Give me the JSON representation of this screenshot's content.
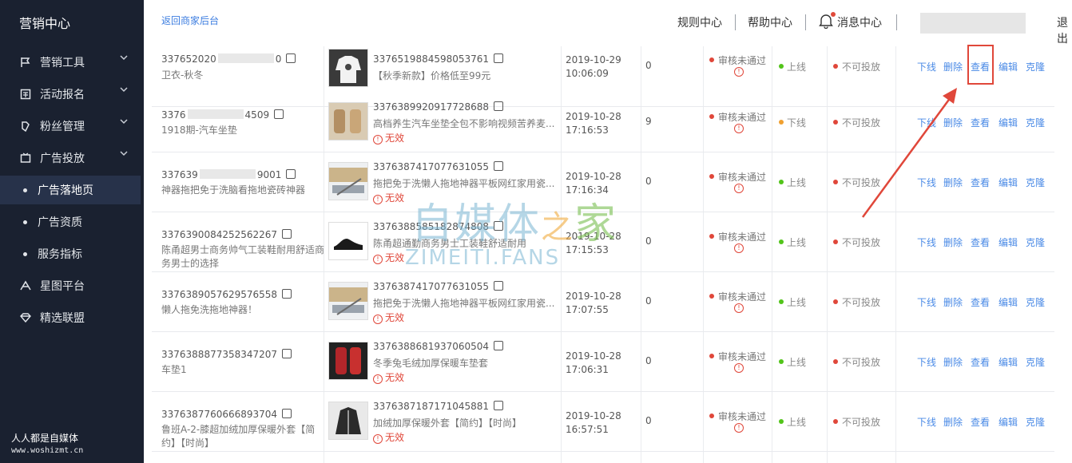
{
  "sidebar": {
    "brand": "营销中心",
    "items": [
      {
        "label": "营销工具",
        "icon": "flag-icon",
        "chevron": "⌄"
      },
      {
        "label": "活动报名",
        "icon": "grid-icon",
        "chevron": "⌄"
      },
      {
        "label": "粉丝管理",
        "icon": "fans-icon",
        "chevron": "⌄"
      },
      {
        "label": "广告投放",
        "icon": "ad-icon",
        "chevron": "⌄"
      },
      {
        "label": "广告落地页",
        "sub": true,
        "active": true
      },
      {
        "label": "广告资质",
        "sub": true
      },
      {
        "label": "服务指标",
        "sub": true
      },
      {
        "label": "星图平台",
        "icon": "star-platform-icon"
      },
      {
        "label": "精选联盟",
        "icon": "diamond-icon"
      }
    ],
    "footer_line1": "人人都是自媒体",
    "footer_line2": "www.woshizmt.cn"
  },
  "topbar": {
    "back_link": "返回商家后台",
    "rules": "规则中心",
    "help": "帮助中心",
    "messages": "消息中心",
    "logout": "退出"
  },
  "colors": {
    "sidebar_bg": "#1a2130",
    "link_blue": "#4a8ae6",
    "red": "#e0473a",
    "green": "#52c41a"
  },
  "rows": [
    {
      "id": "337652020",
      "id_tail": "0",
      "name": "卫衣-秋冬",
      "ad_id": "3376519884598053761",
      "title": "【秋季新款】价格低至99元",
      "invalid": "",
      "date": "2019-10-29",
      "time": "10:06:09",
      "num": "0",
      "audit": "审核未通过",
      "status": "上线",
      "status_color": "#52c41a",
      "deliver": "不可投放",
      "thumb": "hoodie"
    },
    {
      "id": "3376",
      "id_tail": "4509",
      "name": "1918期-汽车坐垫",
      "ad_id": "3376389920917728688",
      "title": "高档养生汽车坐垫全包不影响视频苦养麦...",
      "invalid": "无效",
      "date": "2019-10-28",
      "time": "17:16:53",
      "num": "9",
      "audit": "审核未通过",
      "status": "下线",
      "status_color": "#f0a030",
      "deliver": "不可投放",
      "thumb": "seat"
    },
    {
      "id": "337639",
      "id_tail": "9001",
      "name": "神器拖把免于洗脑看拖地瓷砖神器",
      "ad_id": "3376387417077631055",
      "title": "拖把免于洗懒人拖地神器平板网红家用瓷...",
      "invalid": "无效",
      "date": "2019-10-28",
      "time": "17:16:34",
      "num": "0",
      "audit": "审核未通过",
      "status": "上线",
      "status_color": "#52c41a",
      "deliver": "不可投放",
      "thumb": "mop"
    },
    {
      "id": "3376390084252562267",
      "id_tail": "",
      "name": "陈甬超男士商务帅气工装鞋耐用舒适商务男士的选择",
      "ad_id": "3376388585182874808",
      "title": "陈甬超通勤商务男士工装鞋舒适耐用",
      "invalid": "无效",
      "date": "2019-10-28",
      "time": "17:15:53",
      "num": "0",
      "audit": "审核未通过",
      "status": "上线",
      "status_color": "#52c41a",
      "deliver": "不可投放",
      "thumb": "shoe"
    },
    {
      "id": "3376389057629576558",
      "id_tail": "",
      "name": "懒人拖免洗拖地神器！",
      "ad_id": "3376387417077631055",
      "title": "拖把免于洗懒人拖地神器平板网红家用瓷...",
      "invalid": "无效",
      "date": "2019-10-28",
      "time": "17:07:55",
      "num": "0",
      "audit": "审核未通过",
      "status": "上线",
      "status_color": "#52c41a",
      "deliver": "不可投放",
      "thumb": "mop"
    },
    {
      "id": "3376388877358347207",
      "id_tail": "",
      "name": "车垫1",
      "ad_id": "3376388681937060504",
      "title": "冬季兔毛绒加厚保暖车垫套",
      "invalid": "无效",
      "date": "2019-10-28",
      "time": "17:06:31",
      "num": "0",
      "audit": "审核未通过",
      "status": "上线",
      "status_color": "#52c41a",
      "deliver": "不可投放",
      "thumb": "redseat"
    },
    {
      "id": "3376387760666893704",
      "id_tail": "",
      "name": "鲁班A-2-膝超加绒加厚保暖外套【简约】【时尚】",
      "ad_id": "3376387187171045881",
      "title": "加绒加厚保暖外套【简约】【时尚】",
      "invalid": "无效",
      "date": "2019-10-28",
      "time": "16:57:51",
      "num": "0",
      "audit": "审核未通过",
      "status": "上线",
      "status_color": "#52c41a",
      "deliver": "不可投放",
      "thumb": "jacket"
    }
  ],
  "actions": [
    "下线",
    "删除",
    "查看",
    "编辑",
    "克隆"
  ],
  "watermark": {
    "cn1": "自媒体",
    "cn2": "之",
    "cn3": "家",
    "en": "ZIMEITI.FANS"
  }
}
